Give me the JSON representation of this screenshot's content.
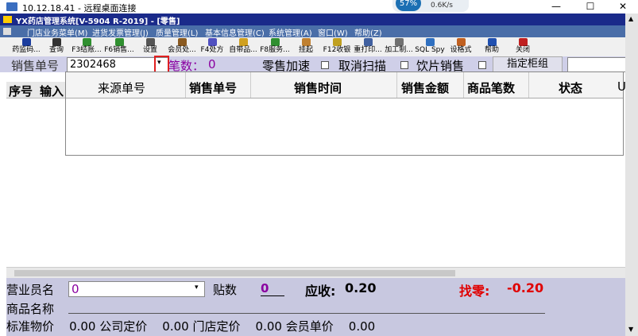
{
  "rdp": {
    "title": "10.12.18.41 - 远程桌面连接",
    "minimize": "—",
    "maximize": "☐",
    "close": "✕",
    "overlay_percent": "57%",
    "overlay_speed": "0.6K/s"
  },
  "app": {
    "title": "YX药店管理系统[V-5904 R-2019] - [零售]"
  },
  "menu": [
    "门店业务菜单(M)",
    "进货发票管理(J)",
    "质量管理(L)",
    "基本信息管理(C)",
    "系统管理(A)",
    "窗口(W)",
    "帮助(Z)"
  ],
  "toolbar": [
    {
      "label": "药监码...",
      "color": "#1b3d9e"
    },
    {
      "label": "查询",
      "color": "#333333"
    },
    {
      "label": "F3结账...",
      "color": "#2f8f2f"
    },
    {
      "label": "F6销售...",
      "color": "#2f8f2f"
    },
    {
      "label": "设置",
      "color": "#555555"
    },
    {
      "label": "会员处...",
      "color": "#8a5a20"
    },
    {
      "label": "F4处方",
      "color": "#5050c0"
    },
    {
      "label": "自带品...",
      "color": "#d0a020"
    },
    {
      "label": "F8服务...",
      "color": "#2f8f2f"
    },
    {
      "label": "挂起",
      "color": "#c08030"
    },
    {
      "label": "F12收银",
      "color": "#c0a020"
    },
    {
      "label": "重打印...",
      "color": "#4060a0"
    },
    {
      "label": "加工制...",
      "color": "#707070"
    },
    {
      "label": "SQL Spy",
      "color": "#3070c0"
    },
    {
      "label": "设格式",
      "color": "#c06020"
    },
    {
      "label": "帮助",
      "color": "#2050b0"
    },
    {
      "label": "关闭",
      "color": "#c02020"
    }
  ],
  "form": {
    "sale_no_label": "销售单号",
    "sale_no_value": "2302468",
    "count_label": "笔数：",
    "count_value": "0",
    "fast_label": "零售加速",
    "cancel_scan_label": "取消扫描",
    "pieces_label": "饮片销售",
    "counter_button": "指定柜组"
  },
  "left_headers": [
    "序号",
    "输入"
  ],
  "popup_headers": [
    "来源单号",
    "销售单号",
    "销售时间",
    "销售金额",
    "商品笔数",
    "状态",
    "U"
  ],
  "bottom": {
    "clerk_label": "营业员名",
    "clerk_value": "0",
    "stickers_label": "贴数",
    "stickers_value": "0",
    "receivable_label": "应收:",
    "receivable_value": "0.20",
    "change_label": "找零:",
    "change_value": "-0.20",
    "product_label": "商品名称",
    "row3": "标准物价    0.00 公司定价    0.00 门店定价    0.00 会员单价    0.00",
    "footer_fragment": "___"
  },
  "colors": {
    "app_title": "#1a2a8a",
    "menubar": "#4a6ea8",
    "change_red": "#e00000",
    "purple": "#8a00a0"
  }
}
